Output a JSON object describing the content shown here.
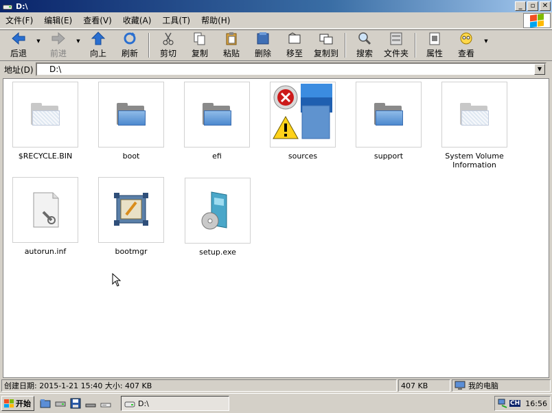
{
  "window": {
    "title": "D:\\"
  },
  "title_buttons": {
    "minimize": "_",
    "maximize": "▫",
    "close": "✕"
  },
  "menu": [
    "文件(F)",
    "编辑(E)",
    "查看(V)",
    "收藏(A)",
    "工具(T)",
    "帮助(H)"
  ],
  "toolbar": {
    "back": "后退",
    "forward": "前进",
    "up": "向上",
    "refresh": "刷新",
    "cut": "剪切",
    "copy": "复制",
    "paste": "粘贴",
    "delete": "删除",
    "move": "移至",
    "copy_to": "复制到",
    "search": "搜索",
    "folders": "文件夹",
    "properties": "属性",
    "view": "查看"
  },
  "address": {
    "label": "地址(D)",
    "value": "D:\\"
  },
  "items": [
    {
      "name": "$RECYCLE.BIN",
      "icon": "folder-hidden-icon"
    },
    {
      "name": "boot",
      "icon": "folder-icon"
    },
    {
      "name": "efi",
      "icon": "folder-icon"
    },
    {
      "name": "sources",
      "icon": "sources-thumbnail-icon"
    },
    {
      "name": "support",
      "icon": "folder-icon"
    },
    {
      "name": "System Volume Information",
      "icon": "folder-hidden-icon"
    },
    {
      "name": "autorun.inf",
      "icon": "settings-file-icon"
    },
    {
      "name": "bootmgr",
      "icon": "bootmgr-file-icon"
    },
    {
      "name": "setup.exe",
      "icon": "setup-exe-icon"
    }
  ],
  "status": {
    "info": "创建日期: 2015-1-21 15:40 大小: 407 KB",
    "size": "407 KB",
    "location": "我的电脑"
  },
  "taskbar": {
    "start": "开始",
    "task": "D:\\",
    "lang": "CH",
    "time": "16:56"
  }
}
